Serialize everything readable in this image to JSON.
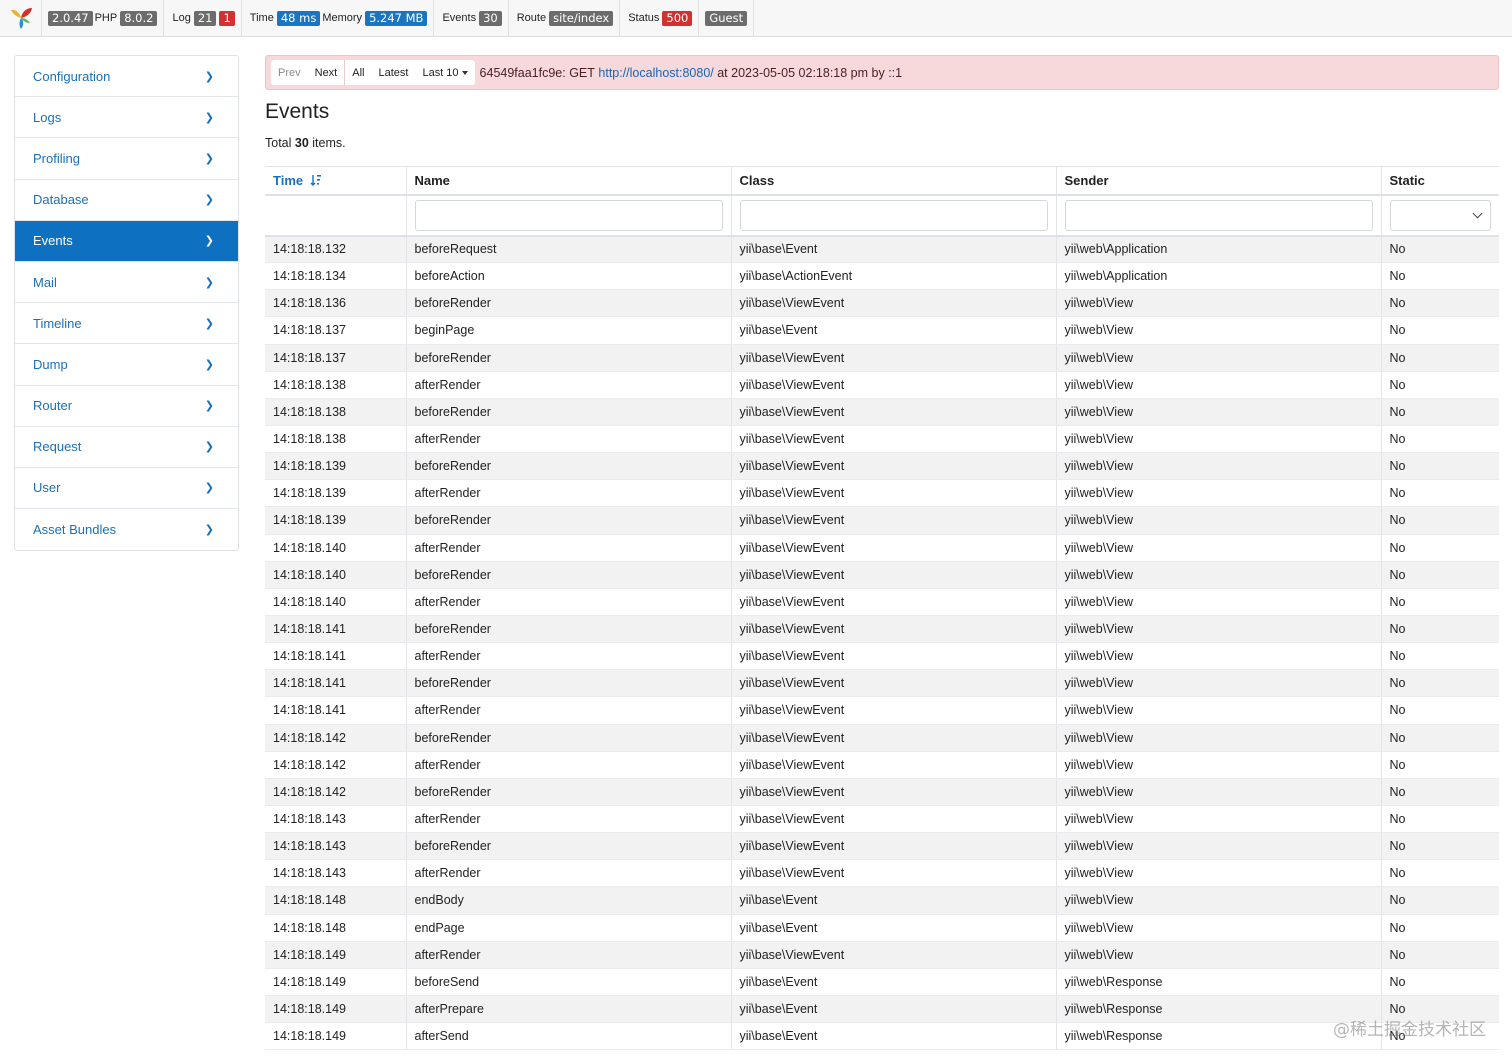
{
  "toolbar": {
    "version": "2.0.47",
    "php_label": "PHP",
    "php_version": "8.0.2",
    "log_label": "Log",
    "log_count": "21",
    "log_errors": "1",
    "time_label": "Time",
    "time_value": "48 ms",
    "memory_label": "Memory",
    "memory_value": "5.247 MB",
    "events_label": "Events",
    "events_count": "30",
    "route_label": "Route",
    "route_value": "site/index",
    "status_label": "Status",
    "status_value": "500",
    "user_value": "Guest"
  },
  "sidebar": {
    "items": [
      {
        "label": "Configuration"
      },
      {
        "label": "Logs"
      },
      {
        "label": "Profiling"
      },
      {
        "label": "Database"
      },
      {
        "label": "Events"
      },
      {
        "label": "Mail"
      },
      {
        "label": "Timeline"
      },
      {
        "label": "Dump"
      },
      {
        "label": "Router"
      },
      {
        "label": "Request"
      },
      {
        "label": "User"
      },
      {
        "label": "Asset Bundles"
      }
    ],
    "active": "Events"
  },
  "summary": {
    "prev": "Prev",
    "next": "Next",
    "all": "All",
    "latest": "Latest",
    "last10": "Last 10",
    "prefix": "64549faa1fc9e: GET",
    "url": "http://localhost:8080/",
    "suffix": "at 2023-05-05 02:18:18 pm by ::1"
  },
  "page": {
    "title": "Events",
    "total_prefix": "Total",
    "total_count": "30",
    "total_suffix": "items."
  },
  "table": {
    "columns": [
      "Time",
      "Name",
      "Class",
      "Sender",
      "Static"
    ],
    "sort_icon": "sort-desc-icon",
    "rows": [
      [
        "14:18:18.132",
        "beforeRequest",
        "yii\\base\\Event",
        "yii\\web\\Application",
        "No"
      ],
      [
        "14:18:18.134",
        "beforeAction",
        "yii\\base\\ActionEvent",
        "yii\\web\\Application",
        "No"
      ],
      [
        "14:18:18.136",
        "beforeRender",
        "yii\\base\\ViewEvent",
        "yii\\web\\View",
        "No"
      ],
      [
        "14:18:18.137",
        "beginPage",
        "yii\\base\\Event",
        "yii\\web\\View",
        "No"
      ],
      [
        "14:18:18.137",
        "beforeRender",
        "yii\\base\\ViewEvent",
        "yii\\web\\View",
        "No"
      ],
      [
        "14:18:18.138",
        "afterRender",
        "yii\\base\\ViewEvent",
        "yii\\web\\View",
        "No"
      ],
      [
        "14:18:18.138",
        "beforeRender",
        "yii\\base\\ViewEvent",
        "yii\\web\\View",
        "No"
      ],
      [
        "14:18:18.138",
        "afterRender",
        "yii\\base\\ViewEvent",
        "yii\\web\\View",
        "No"
      ],
      [
        "14:18:18.139",
        "beforeRender",
        "yii\\base\\ViewEvent",
        "yii\\web\\View",
        "No"
      ],
      [
        "14:18:18.139",
        "afterRender",
        "yii\\base\\ViewEvent",
        "yii\\web\\View",
        "No"
      ],
      [
        "14:18:18.139",
        "beforeRender",
        "yii\\base\\ViewEvent",
        "yii\\web\\View",
        "No"
      ],
      [
        "14:18:18.140",
        "afterRender",
        "yii\\base\\ViewEvent",
        "yii\\web\\View",
        "No"
      ],
      [
        "14:18:18.140",
        "beforeRender",
        "yii\\base\\ViewEvent",
        "yii\\web\\View",
        "No"
      ],
      [
        "14:18:18.140",
        "afterRender",
        "yii\\base\\ViewEvent",
        "yii\\web\\View",
        "No"
      ],
      [
        "14:18:18.141",
        "beforeRender",
        "yii\\base\\ViewEvent",
        "yii\\web\\View",
        "No"
      ],
      [
        "14:18:18.141",
        "afterRender",
        "yii\\base\\ViewEvent",
        "yii\\web\\View",
        "No"
      ],
      [
        "14:18:18.141",
        "beforeRender",
        "yii\\base\\ViewEvent",
        "yii\\web\\View",
        "No"
      ],
      [
        "14:18:18.141",
        "afterRender",
        "yii\\base\\ViewEvent",
        "yii\\web\\View",
        "No"
      ],
      [
        "14:18:18.142",
        "beforeRender",
        "yii\\base\\ViewEvent",
        "yii\\web\\View",
        "No"
      ],
      [
        "14:18:18.142",
        "afterRender",
        "yii\\base\\ViewEvent",
        "yii\\web\\View",
        "No"
      ],
      [
        "14:18:18.142",
        "beforeRender",
        "yii\\base\\ViewEvent",
        "yii\\web\\View",
        "No"
      ],
      [
        "14:18:18.143",
        "afterRender",
        "yii\\base\\ViewEvent",
        "yii\\web\\View",
        "No"
      ],
      [
        "14:18:18.143",
        "beforeRender",
        "yii\\base\\ViewEvent",
        "yii\\web\\View",
        "No"
      ],
      [
        "14:18:18.143",
        "afterRender",
        "yii\\base\\ViewEvent",
        "yii\\web\\View",
        "No"
      ],
      [
        "14:18:18.148",
        "endBody",
        "yii\\base\\Event",
        "yii\\web\\View",
        "No"
      ],
      [
        "14:18:18.148",
        "endPage",
        "yii\\base\\Event",
        "yii\\web\\View",
        "No"
      ],
      [
        "14:18:18.149",
        "afterRender",
        "yii\\base\\ViewEvent",
        "yii\\web\\View",
        "No"
      ],
      [
        "14:18:18.149",
        "beforeSend",
        "yii\\base\\Event",
        "yii\\web\\Response",
        "No"
      ],
      [
        "14:18:18.149",
        "afterPrepare",
        "yii\\base\\Event",
        "yii\\web\\Response",
        "No"
      ],
      [
        "14:18:18.149",
        "afterSend",
        "yii\\base\\Event",
        "yii\\web\\Response",
        "No"
      ]
    ]
  },
  "watermark": "@稀土掘金技术社区",
  "colors": {
    "accent": "#0e70c0",
    "summary_bg": "#f7d9dc",
    "badge_gray": "#6c6c6c",
    "badge_blue": "#1a74c1",
    "badge_red": "#d1312f"
  }
}
